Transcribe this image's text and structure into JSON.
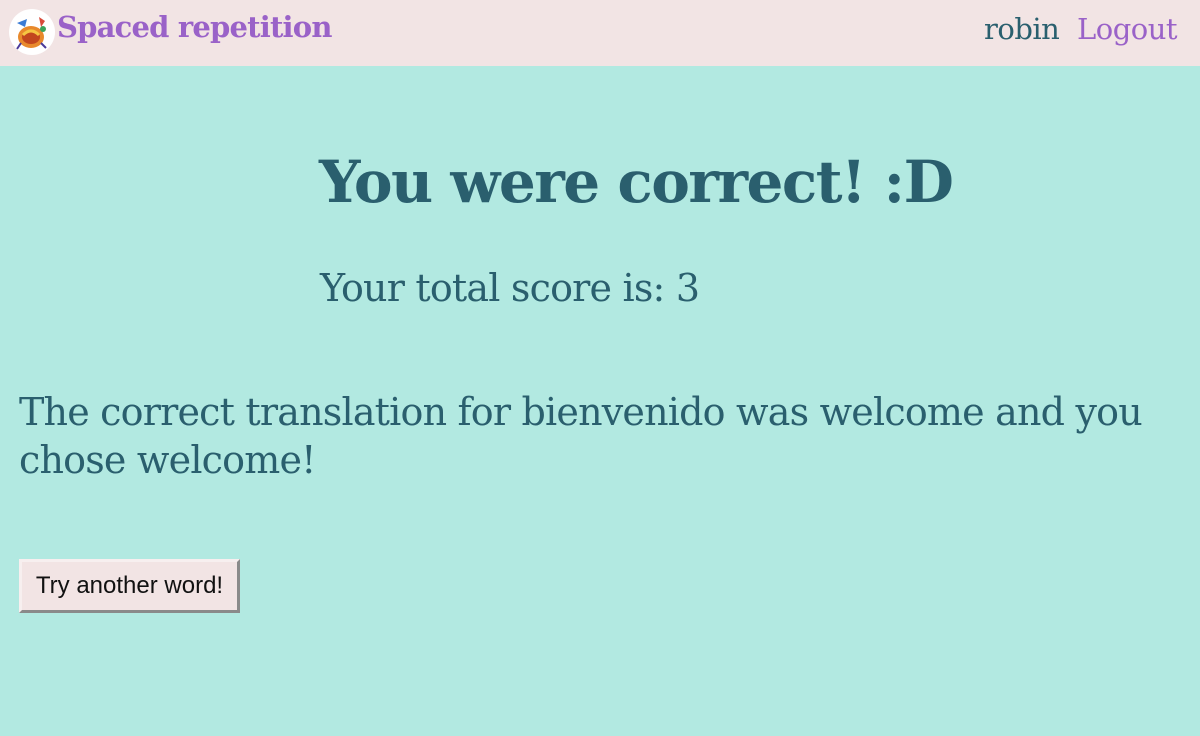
{
  "header": {
    "app_title": "Spaced repetition",
    "username": "robin",
    "logout_label": "Logout"
  },
  "result": {
    "heading": "You were correct! :D",
    "score_text": "Your total score is: 3",
    "feedback": "The correct translation for bienvenido was welcome and you chose welcome!",
    "next_button_label": "Try another word!"
  },
  "colors": {
    "background": "#b2e9e1",
    "header_background": "#f2e4e4",
    "text": "#2a5f6e",
    "accent": "#9a62c8"
  }
}
